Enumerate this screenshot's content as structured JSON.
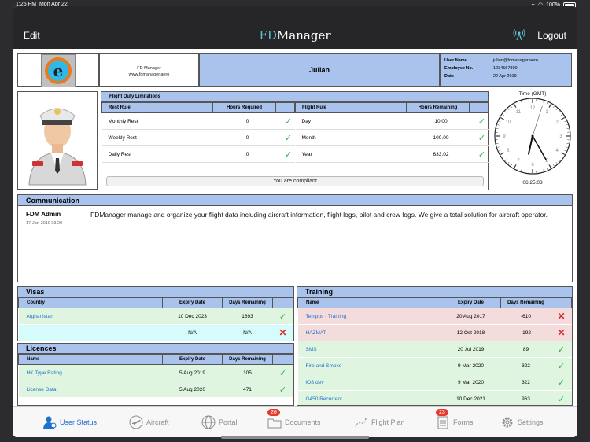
{
  "status_bar": {
    "time": "1:25 PM",
    "date": "Mon Apr 22",
    "battery": "100%"
  },
  "navbar": {
    "edit": "Edit",
    "title_fd": "FD",
    "title_rest": "Manager",
    "logout": "Logout"
  },
  "header": {
    "company_name": "FD Manager",
    "company_site": "www.fdmanager.aero",
    "pilot_name": "Julian",
    "user_name_label": "User Name",
    "user_name": "julian@fdmanager.aero",
    "employee_label": "Employee No.",
    "employee_no": "1234567890",
    "date_label": "Date",
    "date": "22 Apr 2019"
  },
  "fdl": {
    "title": "Flight Duty Limitations",
    "rest_headers": [
      "Rest Rule",
      "Hours Required"
    ],
    "rest_rows": [
      {
        "rule": "Monthly Rest",
        "hours": "0"
      },
      {
        "rule": "Weekly Rest",
        "hours": "0"
      },
      {
        "rule": "Daily Rest",
        "hours": "0"
      }
    ],
    "flight_headers": [
      "Flight Rule",
      "Hours Remaining"
    ],
    "flight_rows": [
      {
        "rule": "Day",
        "hours": "10.00"
      },
      {
        "rule": "Month",
        "hours": "100.00"
      },
      {
        "rule": "Year",
        "hours": "633.02"
      }
    ],
    "compliance": "You are compliant"
  },
  "clock": {
    "label": "Time (GMT)",
    "time": "06:25:03",
    "hours": 6,
    "minutes": 25,
    "seconds": 3,
    "numerals": [
      "12",
      "1",
      "2",
      "3",
      "4",
      "5",
      "6",
      "7",
      "8",
      "9",
      "10",
      "11"
    ]
  },
  "communication": {
    "title": "Communication",
    "sender": "FDM Admin",
    "date": "17-Jan-2019 03:20",
    "message": "FDManager manage and organize your flight data including aircraft information, flight logs, pilot and crew logs. We give a total solution for aircraft operator."
  },
  "visas": {
    "title": "Visas",
    "headers": [
      "Country",
      "Expiry Date",
      "Days Remaining"
    ],
    "rows": [
      {
        "name": "Afghanistan",
        "expiry": "10 Dec 2023",
        "days": "1693",
        "status": "ok",
        "tint": "green"
      },
      {
        "name": "",
        "expiry": "N/A",
        "days": "N/A",
        "status": "bad",
        "tint": "cyan"
      }
    ]
  },
  "licences": {
    "title": "Licences",
    "headers": [
      "Name",
      "Expiry Date",
      "Days Remaining"
    ],
    "rows": [
      {
        "name": "HK Type Rating",
        "expiry": "5 Aug 2019",
        "days": "105",
        "status": "ok",
        "tint": "green"
      },
      {
        "name": "License Data",
        "expiry": "5 Aug 2020",
        "days": "471",
        "status": "ok",
        "tint": "green"
      }
    ]
  },
  "training": {
    "title": "Training",
    "headers": [
      "Name",
      "Expiry Date",
      "Days Remaining"
    ],
    "rows": [
      {
        "name": "Tempus - Training",
        "expiry": "20 Aug 2017",
        "days": "-610",
        "status": "bad",
        "tint": "red"
      },
      {
        "name": "HAZMAT",
        "expiry": "12 Oct 2018",
        "days": "-192",
        "status": "bad",
        "tint": "red"
      },
      {
        "name": "SMS",
        "expiry": "20 Jul 2019",
        "days": "89",
        "status": "ok",
        "tint": "green"
      },
      {
        "name": "Fire and Smoke",
        "expiry": "9 Mar 2020",
        "days": "322",
        "status": "ok",
        "tint": "green"
      },
      {
        "name": "iOS dev",
        "expiry": "9 Mar 2020",
        "days": "322",
        "status": "ok",
        "tint": "green"
      },
      {
        "name": "G450 Recurrent",
        "expiry": "10 Dec 2021",
        "days": "963",
        "status": "ok",
        "tint": "green"
      }
    ]
  },
  "tabs": [
    {
      "label": "User Status",
      "icon": "user-icon",
      "active": true
    },
    {
      "label": "Aircraft",
      "icon": "airplane-icon",
      "active": false
    },
    {
      "label": "Portal",
      "icon": "globe-icon",
      "active": false
    },
    {
      "label": "Documents",
      "icon": "folder-icon",
      "active": false,
      "badge": "26"
    },
    {
      "label": "Flight Plan",
      "icon": "flight-path-icon",
      "active": false
    },
    {
      "label": "Forms",
      "icon": "document-icon",
      "active": false,
      "badge": "23"
    },
    {
      "label": "Settings",
      "icon": "gear-icon",
      "active": false
    }
  ],
  "colors": {
    "header_blue": "#a9c3ec",
    "ok_green": "#2eb83d",
    "bad_red": "#e02424",
    "link_blue": "#1f6fce"
  }
}
